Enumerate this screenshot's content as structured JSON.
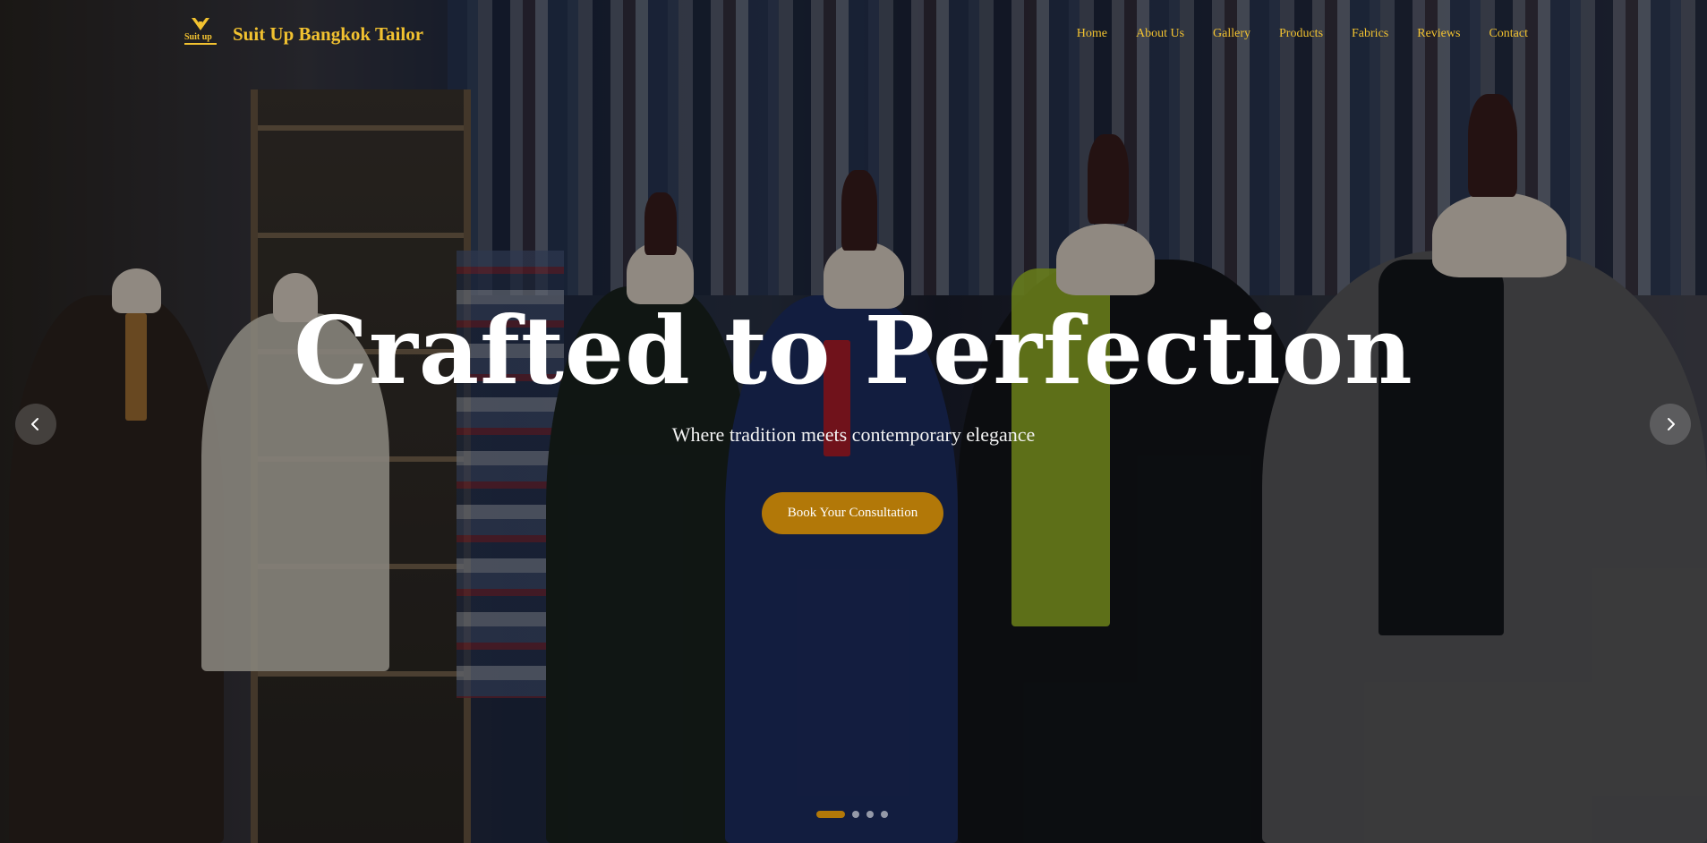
{
  "brand": {
    "name": "Suit Up Bangkok Tailor",
    "logo_text": "Suit up",
    "accent_color": "#f2c230"
  },
  "nav": {
    "items": [
      {
        "label": "Home"
      },
      {
        "label": "About Us"
      },
      {
        "label": "Gallery"
      },
      {
        "label": "Products"
      },
      {
        "label": "Fabrics"
      },
      {
        "label": "Reviews"
      },
      {
        "label": "Contact"
      }
    ]
  },
  "hero": {
    "title": "Crafted to Perfection",
    "subtitle": "Where tradition meets contemporary elegance",
    "cta_label": "Book Your Consultation",
    "cta_color": "#b27808",
    "prev_icon": "chevron-left-icon",
    "next_icon": "chevron-right-icon",
    "slides": {
      "count": 4,
      "active_index": 1
    }
  }
}
